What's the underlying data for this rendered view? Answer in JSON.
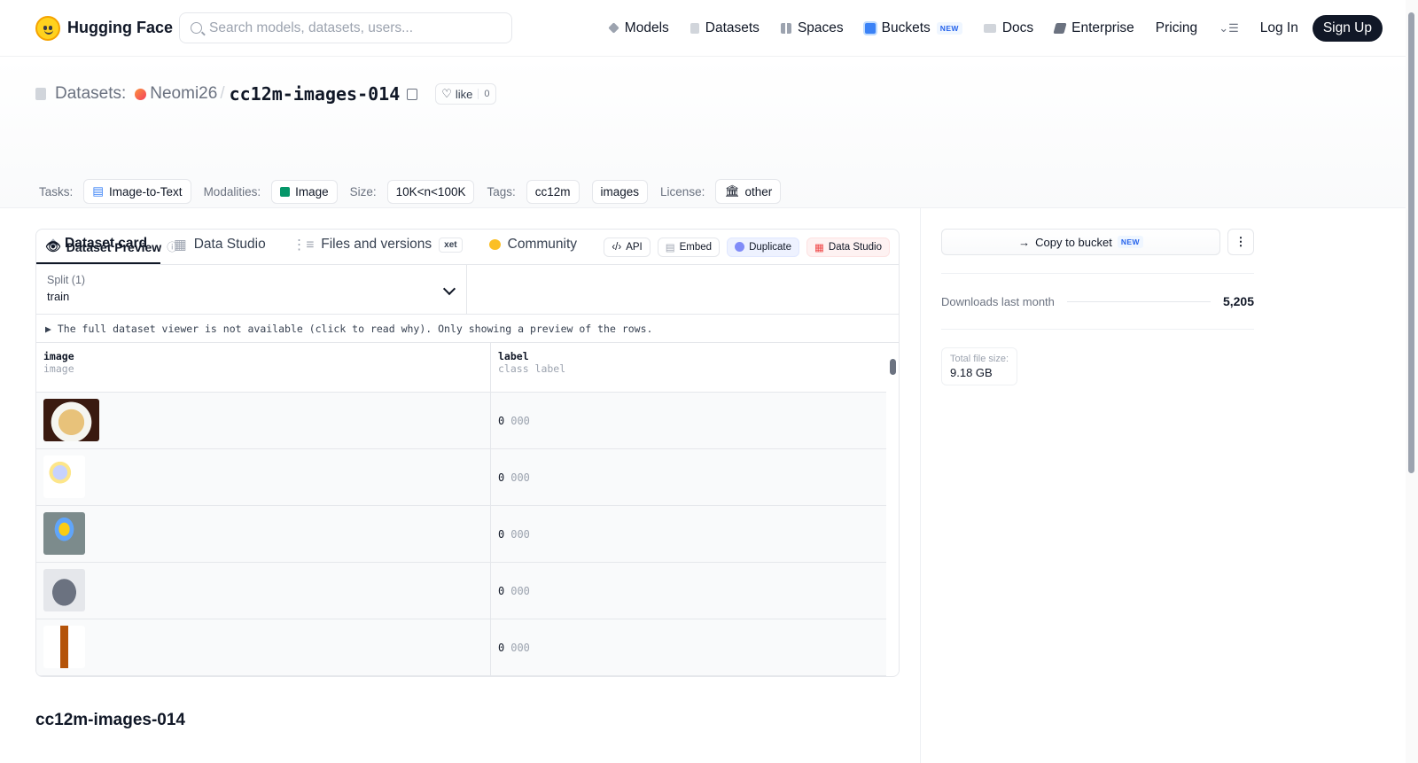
{
  "nav": {
    "brand": "Hugging Face",
    "search_placeholder": "Search models, datasets, users...",
    "items": [
      {
        "label": "Models",
        "icon": "cube-icon",
        "color": "#9ca3af"
      },
      {
        "label": "Datasets",
        "icon": "database-icon",
        "color": "#9ca3af"
      },
      {
        "label": "Spaces",
        "icon": "grid-icon",
        "color": "#9ca3af"
      },
      {
        "label": "Buckets",
        "icon": "bucket-icon",
        "color": "#3b82f6",
        "badge": "NEW"
      },
      {
        "label": "Docs",
        "icon": "book-icon",
        "color": "#9ca3af"
      },
      {
        "label": "Enterprise",
        "icon": "enterprise-icon",
        "color": "#6b7280"
      },
      {
        "label": "Pricing"
      }
    ],
    "login": "Log In",
    "signup": "Sign Up"
  },
  "header": {
    "section": "Datasets:",
    "owner": "Neomi26",
    "separator": "/",
    "repo": "cc12m-images-014",
    "like_label": "like",
    "like_count": "0",
    "tasks_label": "Tasks:",
    "task": "Image-to-Text",
    "modalities_label": "Modalities:",
    "modality": "Image",
    "size_label": "Size:",
    "size": "10K<n<100K",
    "tags_label": "Tags:",
    "tags": [
      "cc12m",
      "images"
    ],
    "license_label": "License:",
    "license": "other"
  },
  "tabs": [
    {
      "label": "Dataset card",
      "active": true
    },
    {
      "label": "Data Studio"
    },
    {
      "label": "Files and versions",
      "badge": "xet"
    },
    {
      "label": "Community"
    }
  ],
  "preview": {
    "title": "Dataset Preview",
    "actions": {
      "api": "API",
      "embed": "Embed",
      "duplicate": "Duplicate",
      "data_studio": "Data Studio"
    },
    "split_label": "Split (1)",
    "split_value": "train",
    "notice": "▶ The full dataset viewer is not available (click to read why). Only showing a preview of the rows.",
    "columns": [
      {
        "name": "image",
        "type": "image"
      },
      {
        "name": "label",
        "type": "class label"
      }
    ],
    "rows": [
      {
        "thumb": "food-plate-thumbnail",
        "value": "0",
        "class_name": "000"
      },
      {
        "thumb": "sticker-art-thumbnail",
        "value": "0",
        "class_name": "000"
      },
      {
        "thumb": "hot-air-balloon-thumbnail",
        "value": "0",
        "class_name": "000"
      },
      {
        "thumb": "grey-sweater-thumbnail",
        "value": "0",
        "class_name": "000"
      },
      {
        "thumb": "wooden-cross-thumbnail",
        "value": "0",
        "class_name": "000"
      }
    ]
  },
  "readme_title": "cc12m-images-014",
  "sidebar": {
    "copy_label": "Copy to bucket",
    "copy_badge": "NEW",
    "downloads_label": "Downloads last month",
    "downloads_value": "5,205",
    "file_size_label": "Total file size:",
    "file_size_value": "9.18 GB"
  }
}
